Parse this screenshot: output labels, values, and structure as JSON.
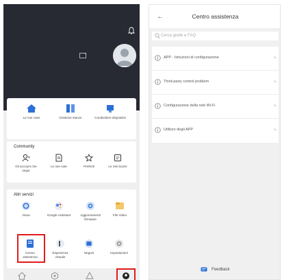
{
  "left": {
    "home_card": {
      "tiles": [
        {
          "label": "Le mie case",
          "icon": "home-icon"
        },
        {
          "label": "Gestione stanze",
          "icon": "room-management-icon"
        },
        {
          "label": "Condividere dispositivi",
          "icon": "share-devices-icon"
        }
      ]
    },
    "community": {
      "title": "Community",
      "tiles": [
        {
          "label": "Gli account che segui",
          "icon": "following-icon"
        },
        {
          "label": "Le mie note",
          "icon": "notes-icon"
        },
        {
          "label": "Preferiti",
          "icon": "star-icon"
        },
        {
          "label": "Le mie bozze",
          "icon": "drafts-icon"
        }
      ]
    },
    "services": {
      "title": "Altri servizi",
      "tiles": [
        {
          "label": "Alexa",
          "icon": "alexa-icon"
        },
        {
          "label": "Google Assistant",
          "icon": "google-assistant-icon"
        },
        {
          "label": "Aggiornamenti firmware",
          "icon": "firmware-update-icon"
        },
        {
          "label": "File Video",
          "icon": "video-files-icon"
        },
        {
          "label": "Centro assistenza",
          "icon": "help-center-icon"
        },
        {
          "label": "Esperienza virtuale",
          "icon": "virtual-experience-icon"
        },
        {
          "label": "Negozi",
          "icon": "store-icon"
        },
        {
          "label": "Impostazioni",
          "icon": "settings-icon"
        }
      ]
    },
    "bottom_nav": [
      "home-icon",
      "scene-icon",
      "mall-icon",
      "profile-icon"
    ]
  },
  "right": {
    "title": "Centro assistenza",
    "search_placeholder": "Cerca guide e FAQ",
    "items": [
      "APP - Istruzioni di configurazione",
      "Third-party control problem",
      "Configurazione della rete Wi-Fi",
      "Utilizzo degli APP"
    ],
    "feedback": "Feedback"
  },
  "colors": {
    "header": "#272a32",
    "accent": "#2c6fd6",
    "highlight": "#e01b1b"
  }
}
